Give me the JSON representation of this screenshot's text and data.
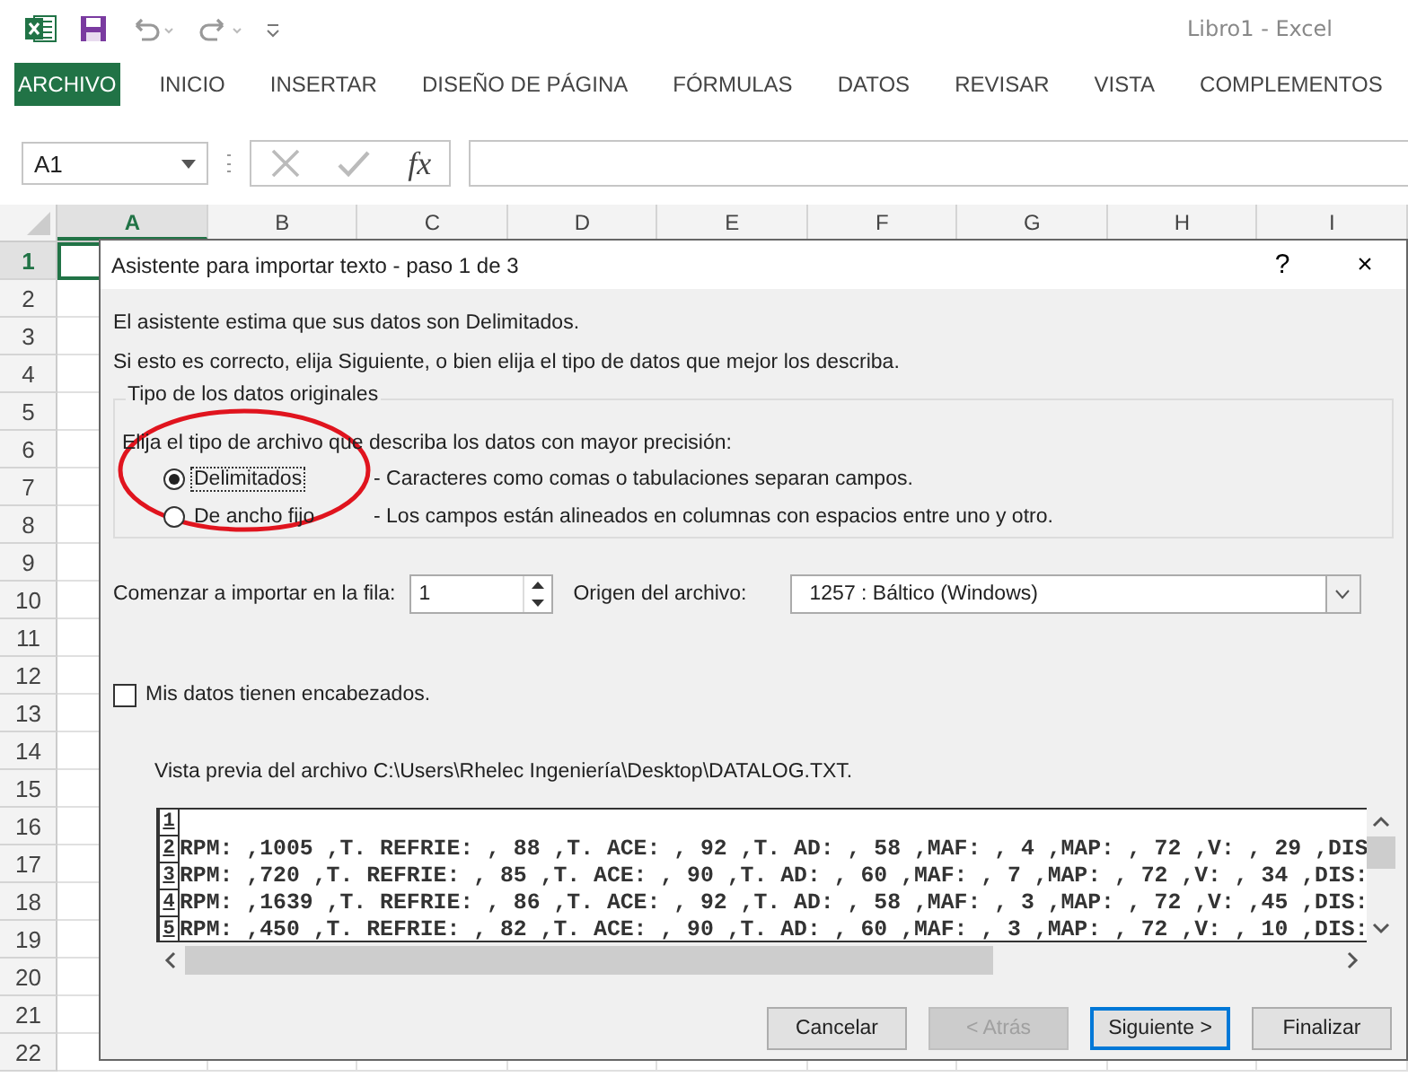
{
  "window": {
    "title": "Libro1 - Excel"
  },
  "ribbon_tabs": [
    {
      "label": "ARCHIVO",
      "selected": true
    },
    {
      "label": "INICIO",
      "selected": false
    },
    {
      "label": "INSERTAR",
      "selected": false
    },
    {
      "label": "DISEÑO DE PÁGINA",
      "selected": false
    },
    {
      "label": "FÓRMULAS",
      "selected": false
    },
    {
      "label": "DATOS",
      "selected": false
    },
    {
      "label": "REVISAR",
      "selected": false
    },
    {
      "label": "VISTA",
      "selected": false
    },
    {
      "label": "COMPLEMENTOS",
      "selected": false
    }
  ],
  "formula_bar": {
    "name_box": "A1",
    "function_label": "fx"
  },
  "sheet": {
    "columns": [
      {
        "label": "A",
        "selected": true
      },
      {
        "label": "B",
        "selected": false
      },
      {
        "label": "C",
        "selected": false
      },
      {
        "label": "D",
        "selected": false
      },
      {
        "label": "E",
        "selected": false
      },
      {
        "label": "F",
        "selected": false
      },
      {
        "label": "G",
        "selected": false
      },
      {
        "label": "H",
        "selected": false
      },
      {
        "label": "I",
        "selected": false
      }
    ],
    "rows": [
      {
        "label": "1",
        "selected": true
      },
      {
        "label": "2",
        "selected": false
      },
      {
        "label": "3",
        "selected": false
      },
      {
        "label": "4",
        "selected": false
      },
      {
        "label": "5",
        "selected": false
      },
      {
        "label": "6",
        "selected": false
      },
      {
        "label": "7",
        "selected": false
      },
      {
        "label": "8",
        "selected": false
      },
      {
        "label": "9",
        "selected": false
      },
      {
        "label": "10",
        "selected": false
      },
      {
        "label": "11",
        "selected": false
      },
      {
        "label": "12",
        "selected": false
      },
      {
        "label": "13",
        "selected": false
      },
      {
        "label": "14",
        "selected": false
      },
      {
        "label": "15",
        "selected": false
      },
      {
        "label": "16",
        "selected": false
      },
      {
        "label": "17",
        "selected": false
      },
      {
        "label": "18",
        "selected": false
      },
      {
        "label": "19",
        "selected": false
      },
      {
        "label": "20",
        "selected": false
      },
      {
        "label": "21",
        "selected": false
      },
      {
        "label": "22",
        "selected": false
      }
    ]
  },
  "dialog": {
    "title": "Asistente para importar texto - paso 1 de 3",
    "help": "?",
    "close": "×",
    "intro": [
      "El asistente estima que sus datos son Delimitados.",
      "Si esto es correcto, elija Siguiente, o bien elija el tipo de datos que mejor los describa."
    ],
    "group_title": "Tipo de los datos originales",
    "prompt": "Elija el tipo de archivo que describa los datos con mayor precisión:",
    "options": [
      {
        "label": "Delimitados",
        "description": "- Caracteres como comas o tabulaciones separan campos.",
        "selected": true,
        "focused": true
      },
      {
        "label": "De ancho fijo",
        "description": "- Los campos están alineados en columnas con espacios entre uno y otro.",
        "selected": false,
        "focused": false
      }
    ],
    "start_row": {
      "label": "Comenzar a importar en la fila:",
      "value": "1"
    },
    "origin": {
      "label": "Origen del archivo:",
      "value": "1257 : Báltico (Windows)"
    },
    "headers": {
      "label": "Mis datos tienen encabezados.",
      "checked": false
    },
    "preview": {
      "label": "Vista previa del archivo C:\\Users\\Rhelec Ingeniería\\Desktop\\DATALOG.TXT.",
      "lines": [
        {
          "number": "1"
        },
        {
          "number": "2",
          "text": "RPM: ,1005 ,T. REFRIE: , 88 ,T. ACE: , 92 ,T. AD: , 58 ,MAF: , 4 ,MAP: , 72 ,V: , 29 ,DIS"
        },
        {
          "number": "3",
          "text": "RPM: ,720 ,T. REFRIE: , 85 ,T. ACE: , 90 ,T. AD: , 60 ,MAF: , 7 ,MAP: , 72 ,V: , 34 ,DIS:"
        },
        {
          "number": "4",
          "text": "RPM: ,1639 ,T. REFRIE: , 86 ,T. ACE: , 92 ,T. AD: , 58 ,MAF: , 3 ,MAP: , 72 ,V: ,45 ,DIS:"
        },
        {
          "number": "5",
          "text": "RPM: ,450 ,T. REFRIE: , 82 ,T. ACE: , 90 ,T. AD: , 60 ,MAF: , 3 ,MAP: , 72 ,V: , 10 ,DIS:"
        }
      ]
    },
    "buttons": [
      {
        "label": "Cancelar",
        "disabled": false,
        "focused": false
      },
      {
        "label": "< Atrás",
        "disabled": true,
        "focused": false
      },
      {
        "label": "Siguiente >",
        "disabled": false,
        "focused": true
      },
      {
        "label": "Finalizar",
        "disabled": false,
        "focused": false
      }
    ]
  }
}
